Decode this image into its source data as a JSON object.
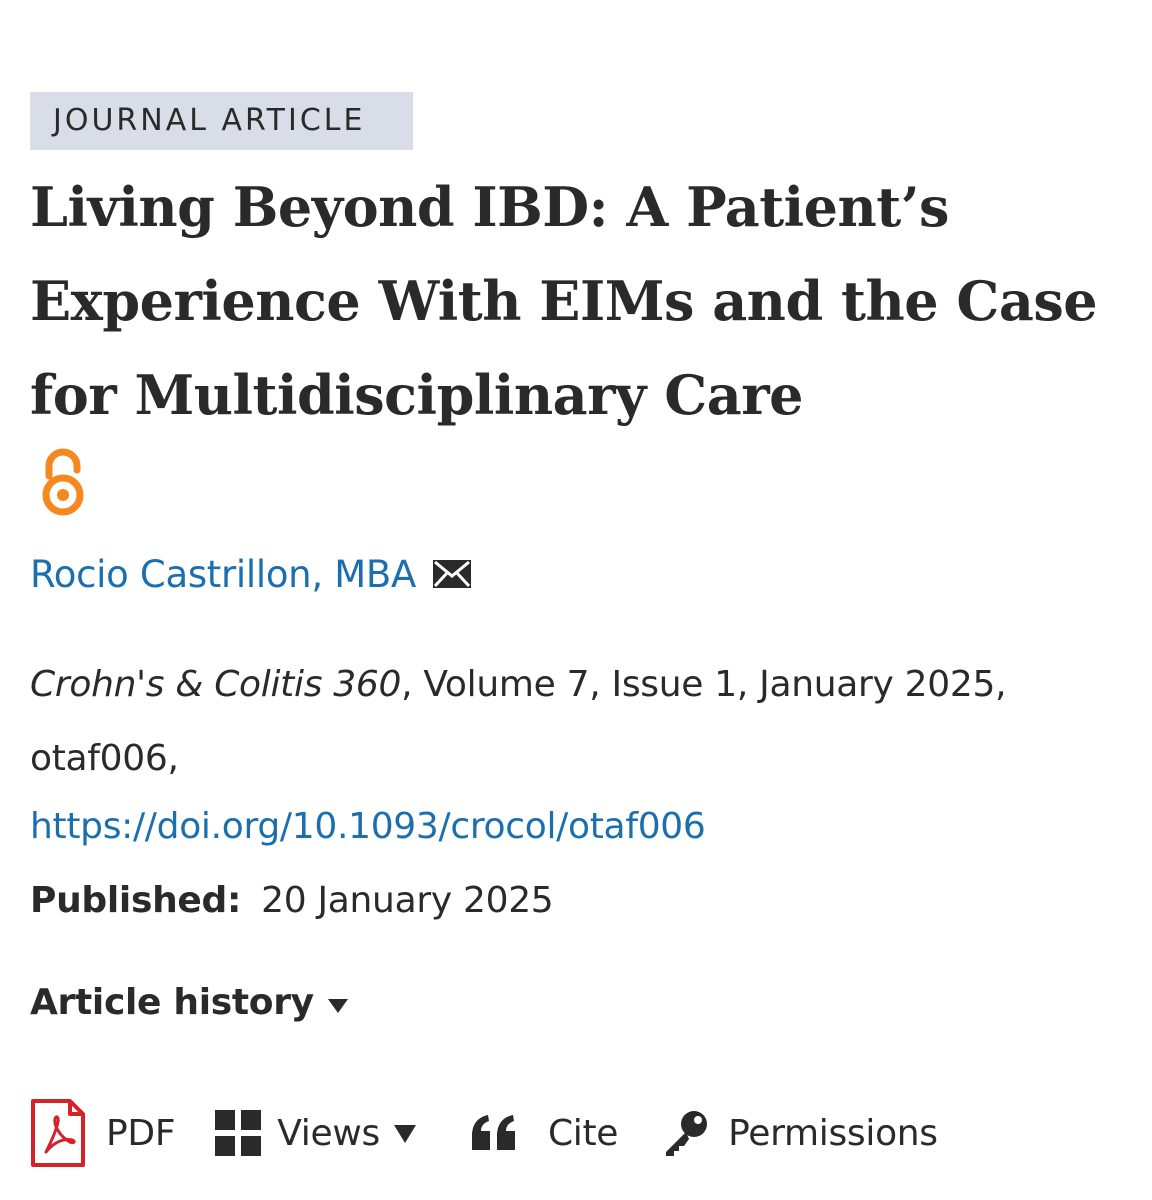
{
  "article": {
    "type_badge": "JOURNAL ARTICLE",
    "title": "Living Beyond IBD: A Patient’s Experience With EIMs and the Case for Multidisciplinary Care",
    "open_access_icon": "open-access-icon",
    "author": "Rocio Castrillon, MBA",
    "author_contact_icon": "mail-icon",
    "citation": {
      "journal": "Crohn's & Colitis 360",
      "details": ", Volume 7, Issue 1, January 2025, otaf006,"
    },
    "doi": "https://doi.org/10.1093/crocol/otaf006",
    "published": {
      "label": "Published:",
      "date": "20 January 2025"
    },
    "history_label": "Article history"
  },
  "toolbar": {
    "pdf_label": "PDF",
    "views_label": "Views",
    "cite_label": "Cite",
    "permissions_label": "Permissions"
  },
  "colors": {
    "badge_bg": "#d9dde8",
    "link": "#1b6fae",
    "open_access": "#f5891f",
    "pdf_red": "#d3222a",
    "text": "#2a2a2a"
  }
}
